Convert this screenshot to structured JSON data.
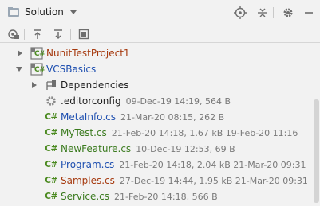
{
  "header": {
    "title": "Solution",
    "icons": [
      "solution-icon",
      "chevron-down-icon",
      "crosshair-icon",
      "collapse-all-icon",
      "gear-icon",
      "minimize-icon"
    ]
  },
  "toolbar": {
    "icons": [
      "show-active-icon",
      "pull-icon",
      "push-icon",
      "stash-icon"
    ]
  },
  "tree": {
    "nodes": [
      {
        "label": "NunitTestProject1",
        "meta": "",
        "icon": "csharp-project-icon",
        "color": "#a63a0f",
        "arrow": "collapsed"
      },
      {
        "label": "VCSBasics",
        "meta": "",
        "icon": "csharp-project-icon",
        "color": "#1e4fb0",
        "arrow": "expanded"
      },
      {
        "label": "Dependencies",
        "meta": "",
        "icon": "dependencies-icon",
        "color": "#1e1e1e",
        "arrow": "collapsed"
      },
      {
        "label": ".editorconfig",
        "meta": "09-Dec-19 14:19, 564 B",
        "icon": "gear-icon",
        "color": "#1e1e1e",
        "arrow": "none"
      },
      {
        "label": "MetaInfo.cs",
        "meta": "21-Mar-20 08:15, 262 B",
        "icon": "csharp-file-icon",
        "color": "#1e4fb0",
        "arrow": "none"
      },
      {
        "label": "MyTest.cs",
        "meta": "21-Feb-20 14:18, 1.67 kB 19-Feb-20 11:16",
        "icon": "csharp-file-icon",
        "color": "#3a7a1e",
        "arrow": "none"
      },
      {
        "label": "NewFeature.cs",
        "meta": "10-Dec-19 12:53, 69 B",
        "icon": "csharp-file-icon",
        "color": "#3a7a1e",
        "arrow": "none"
      },
      {
        "label": "Program.cs",
        "meta": "21-Feb-20 14:18, 2.04 kB 21-Mar-20 09:31",
        "icon": "csharp-file-icon",
        "color": "#1e4fb0",
        "arrow": "none"
      },
      {
        "label": "Samples.cs",
        "meta": "27-Dec-19 14:44, 1.95 kB 21-Mar-20 09:31",
        "icon": "csharp-file-icon",
        "color": "#a63a0f",
        "arrow": "none"
      },
      {
        "label": "Service.cs",
        "meta": "21-Feb-20 14:18, 566 B",
        "icon": "csharp-file-icon",
        "color": "#3a7a1e",
        "arrow": "none"
      }
    ]
  },
  "csharp_glyph": "C#",
  "colors": {
    "background": "#f2f2f2",
    "muted_text": "#7a7a7a",
    "csharp_green": "#4b8a20"
  }
}
